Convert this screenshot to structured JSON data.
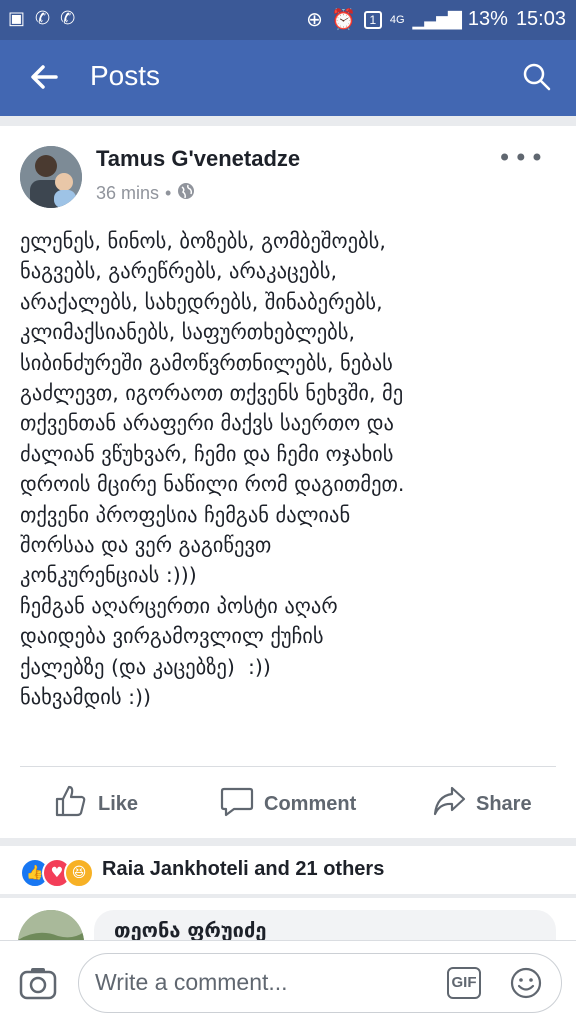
{
  "status_bar": {
    "battery": "13%",
    "time": "15:03",
    "network": "4G",
    "sim": "1"
  },
  "header": {
    "back_icon": "back-arrow-icon",
    "title": "Posts",
    "search_icon": "search-icon"
  },
  "post": {
    "author": "Tamus G'venetadze",
    "time": "36 mins",
    "separator": "•",
    "audience_icon": "globe-icon",
    "more_icon": "more-options-icon",
    "text": "ელენეს, ნინოს, ბოზებს, გომბეშოებს,\nნაგვებს, გარეწრებს, არაკაცებს,\nარაქალებს, სახედრებს, შინაბერებს,\nკლიმაქსიანებს, საფურთხებლებს,\nსიბინძურეში გამოწვრთნილებს, ნებას\nგაძლევთ, იგორაოთ თქვენს ნეხვში, მე\nთქვენთან არაფერი მაქვს საერთო და\nძალიან ვწუხვარ, ჩემი და ჩემი ოჯახის\nდროის მცირე ნაწილი რომ დაგითმეთ.\nთქვენი პროფესია ჩემგან ძალიან\nშორსაა და ვერ გაგიწევთ\nკონკურენციას :)))\nჩემგან აღარცერთი პოსტი აღარ\nდაიდება ვირგამოვლილ ქუჩის\nქალებზე (და კაცებზე)  :))\nნახვამდის :))"
  },
  "actions": {
    "like": "Like",
    "comment": "Comment",
    "share": "Share"
  },
  "reactions": {
    "summary": "Raia Jankhoteli and 21 others"
  },
  "first_comment": {
    "name": "თეონა ფრუიძე"
  },
  "composer": {
    "placeholder": "Write a comment...",
    "gif": "GIF"
  },
  "colors": {
    "brand": "#4267b2",
    "statusbar": "#3b5997",
    "text": "#1d2129",
    "muted": "#606770"
  }
}
